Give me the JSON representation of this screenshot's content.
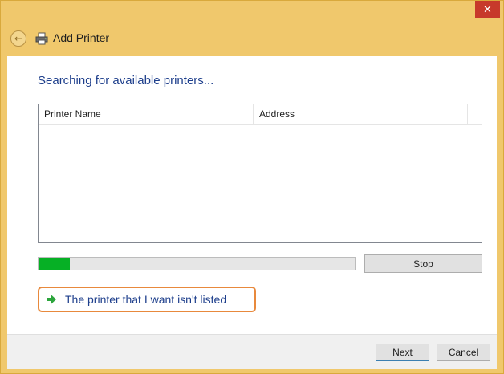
{
  "window": {
    "title": "Add Printer",
    "close_glyph": "✕"
  },
  "main": {
    "heading": "Searching for available printers...",
    "columns": [
      "Printer Name",
      "Address"
    ],
    "progress_percent": 10,
    "stop_label": "Stop",
    "not_listed_link": "The printer that I want isn't listed"
  },
  "footer": {
    "next_label": "Next",
    "cancel_label": "Cancel"
  },
  "icons": {
    "back": "back-arrow-icon",
    "printer": "printer-icon",
    "link_arrow": "green-arrow-icon",
    "close": "close-icon"
  },
  "colors": {
    "frame": "#f0c86c",
    "heading_blue": "#1e3f8c",
    "progress_green": "#06b025",
    "close_red": "#c7392b",
    "link_highlight": "#e8893c"
  }
}
